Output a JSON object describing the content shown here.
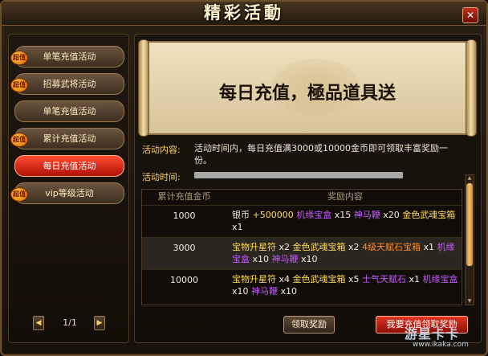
{
  "window": {
    "title": "精彩活動"
  },
  "sidebar": {
    "items": [
      {
        "label": "单笔充值活动",
        "hot": true,
        "active": false
      },
      {
        "label": "招募武将活动",
        "hot": true,
        "active": false
      },
      {
        "label": "单笔充值活动",
        "hot": false,
        "active": false
      },
      {
        "label": "累计充值活动",
        "hot": true,
        "active": false
      },
      {
        "label": "每日充值活动",
        "hot": false,
        "active": true
      },
      {
        "label": "vip等级活动",
        "hot": true,
        "active": false
      }
    ],
    "hot_badge": "超值",
    "pager": "1/1"
  },
  "banner": {
    "title": "每日充值，極品道具送"
  },
  "activity": {
    "content_label": "活动内容:",
    "content_value": "活动时间内，每日充值满3000或10000金币即可领取丰富奖励一份。",
    "time_label": "活动时间:"
  },
  "table": {
    "headers": [
      "累计充值金币",
      "奖励内容"
    ],
    "rows": [
      {
        "amount": "1000",
        "reward": [
          {
            "t": "银币 ",
            "c": "white"
          },
          {
            "t": "+500000 ",
            "c": "yellow"
          },
          {
            "t": "机缘宝盒",
            "c": "purple"
          },
          {
            "t": " x15 ",
            "c": "white"
          },
          {
            "t": "神马鞭",
            "c": "purple"
          },
          {
            "t": " x20 ",
            "c": "white"
          },
          {
            "t": "金色武魂宝箱",
            "c": "yellow"
          },
          {
            "t": " x1",
            "c": "white"
          }
        ]
      },
      {
        "amount": "3000",
        "reward": [
          {
            "t": "宝物升星符",
            "c": "yellow"
          },
          {
            "t": " x2 ",
            "c": "white"
          },
          {
            "t": "金色武魂宝箱",
            "c": "yellow"
          },
          {
            "t": " x2 ",
            "c": "white"
          },
          {
            "t": "4级天赋石宝箱",
            "c": "orange"
          },
          {
            "t": " x1 ",
            "c": "white"
          },
          {
            "t": "机缘宝盒",
            "c": "purple"
          },
          {
            "t": " x10 ",
            "c": "white"
          },
          {
            "t": "神马鞭",
            "c": "purple"
          },
          {
            "t": " x10",
            "c": "white"
          }
        ]
      },
      {
        "amount": "10000",
        "reward": [
          {
            "t": "宝物升星符",
            "c": "yellow"
          },
          {
            "t": " x4 ",
            "c": "white"
          },
          {
            "t": "金色武魂宝箱",
            "c": "yellow"
          },
          {
            "t": " x5 ",
            "c": "white"
          },
          {
            "t": "士气天赋石",
            "c": "purple"
          },
          {
            "t": " x1 ",
            "c": "white"
          },
          {
            "t": "机缘宝盒",
            "c": "purple"
          },
          {
            "t": " x10 ",
            "c": "white"
          },
          {
            "t": "神马鞭",
            "c": "purple"
          },
          {
            "t": " x10",
            "c": "white"
          }
        ]
      }
    ]
  },
  "buttons": {
    "claim": "领取奖励",
    "recharge": "我要充值领取奖励"
  },
  "watermark": {
    "name": "游星卡卡",
    "url": "www.ikaka.com"
  },
  "icons": {
    "close": "close-icon",
    "prev": "chevron-left-icon",
    "next": "chevron-right-icon"
  }
}
